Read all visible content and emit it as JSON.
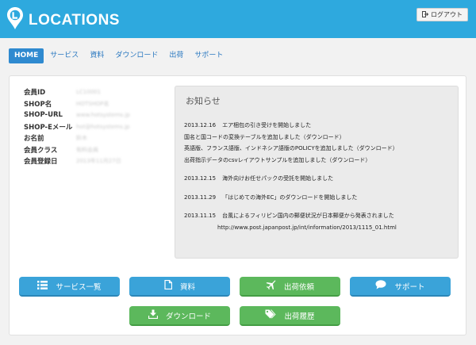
{
  "header": {
    "logo_text": "LOCATIONS",
    "logout_label": "ログアウト",
    "logout_icon": "sign-out-icon",
    "color": "#2ea9de"
  },
  "nav": {
    "items": [
      "HOME",
      "サービス",
      "資料",
      "ダウンロード",
      "出荷",
      "サポート"
    ],
    "active": "HOME"
  },
  "member": {
    "rows": [
      {
        "label": "会員ID",
        "value": "LC10001"
      },
      {
        "label": "SHOP名",
        "value": "HOTSHOP名"
      },
      {
        "label": "SHOP-URL",
        "value": "www.hotsystems.jp"
      },
      {
        "label": "SHOP-Eメール",
        "value": "hot@hotsystems.jp"
      },
      {
        "label": "お名前",
        "value": "鈴木"
      },
      {
        "label": "会員クラス",
        "value": "有料会員"
      },
      {
        "label": "会員登録日",
        "value": "2013年11月27日"
      }
    ]
  },
  "notice": {
    "title": "お知らせ",
    "items": [
      {
        "date": "2013.12.16",
        "lines": [
          "エア梱包の引き受けを開始しました",
          "国名と国コードの変換テーブルを追加しました（ダウンロード）",
          "英語版、フランス語版、インドネシア語版のPOLICYを追加しました（ダウンロード）",
          "出荷指示データのcsvレイアウトサンプルを追加しました（ダウンロード）"
        ]
      },
      {
        "date": "2013.12.15",
        "lines": [
          "海外向けお任せパックの受託を開始しました"
        ]
      },
      {
        "date": "2013.11.29",
        "lines": [
          "「はじめての海外EC」のダウンロードを開始しました"
        ]
      },
      {
        "date": "2013.11.15",
        "lines": [
          "台風によるフィリピン国内の郵便状況が日本郵便から発表されました",
          "http://www.post.japanpost.jp/int/information/2013/1115_01.html"
        ]
      }
    ]
  },
  "buttons": {
    "services": {
      "label": "サービス一覧",
      "icon": "list-icon"
    },
    "documents": {
      "label": "資料",
      "icon": "document-icon"
    },
    "shipping_request": {
      "label": "出荷依頼",
      "icon": "plane-icon"
    },
    "support": {
      "label": "サポート",
      "icon": "chat-bubble-icon"
    },
    "download": {
      "label": "ダウンロード",
      "icon": "download-icon"
    },
    "shipping_history": {
      "label": "出荷履歴",
      "icon": "tags-icon"
    }
  },
  "colors": {
    "blue_button": "#3aa3d9",
    "green_button": "#5cb85c",
    "nav_active": "#2f8ad0"
  }
}
